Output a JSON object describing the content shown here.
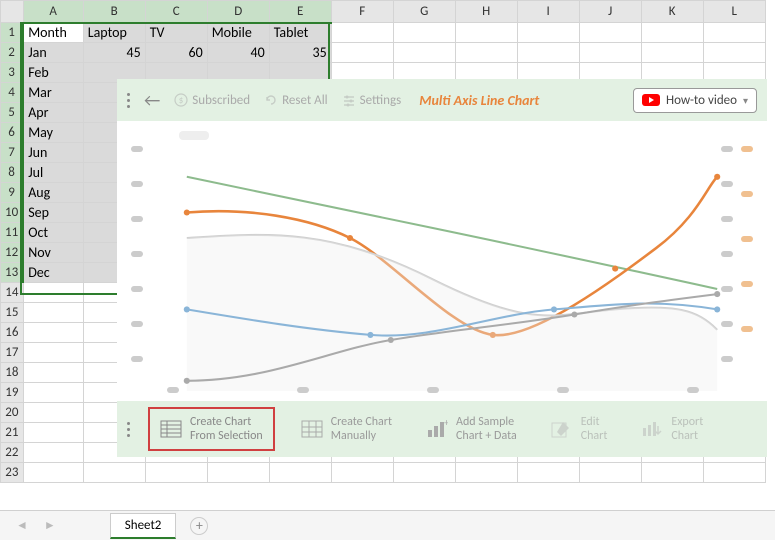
{
  "columns": [
    "",
    "A",
    "B",
    "C",
    "D",
    "E",
    "F",
    "G",
    "H",
    "I",
    "J",
    "K",
    "L"
  ],
  "rows": {
    "r1": {
      "A": "Month",
      "B": "Laptop",
      "C": "TV",
      "D": "Mobile",
      "E": "Tablet"
    },
    "r2": {
      "A": "Jan",
      "B": "45",
      "C": "60",
      "D": "40",
      "E": "35"
    },
    "r3": {
      "A": "Feb"
    },
    "r4": {
      "A": "Mar"
    },
    "r5": {
      "A": "Apr"
    },
    "r6": {
      "A": "May"
    },
    "r7": {
      "A": "Jun"
    },
    "r8": {
      "A": "Jul"
    },
    "r9": {
      "A": "Aug"
    },
    "r10": {
      "A": "Sep"
    },
    "r11": {
      "A": "Oct"
    },
    "r12": {
      "A": "Nov"
    },
    "r13": {
      "A": "Dec"
    }
  },
  "header": {
    "subscribed": "Subscribed",
    "reset": "Reset All",
    "settings": "Settings",
    "title": "Multi Axis Line Chart",
    "howto": "How-to video"
  },
  "footer": {
    "create_sel": "Create Chart\nFrom Selection",
    "create_man": "Create Chart\nManually",
    "sample": "Add Sample\nChart + Data",
    "edit": "Edit\nChart",
    "export": "Export\nChart"
  },
  "sheet": {
    "name": "Sheet2"
  }
}
